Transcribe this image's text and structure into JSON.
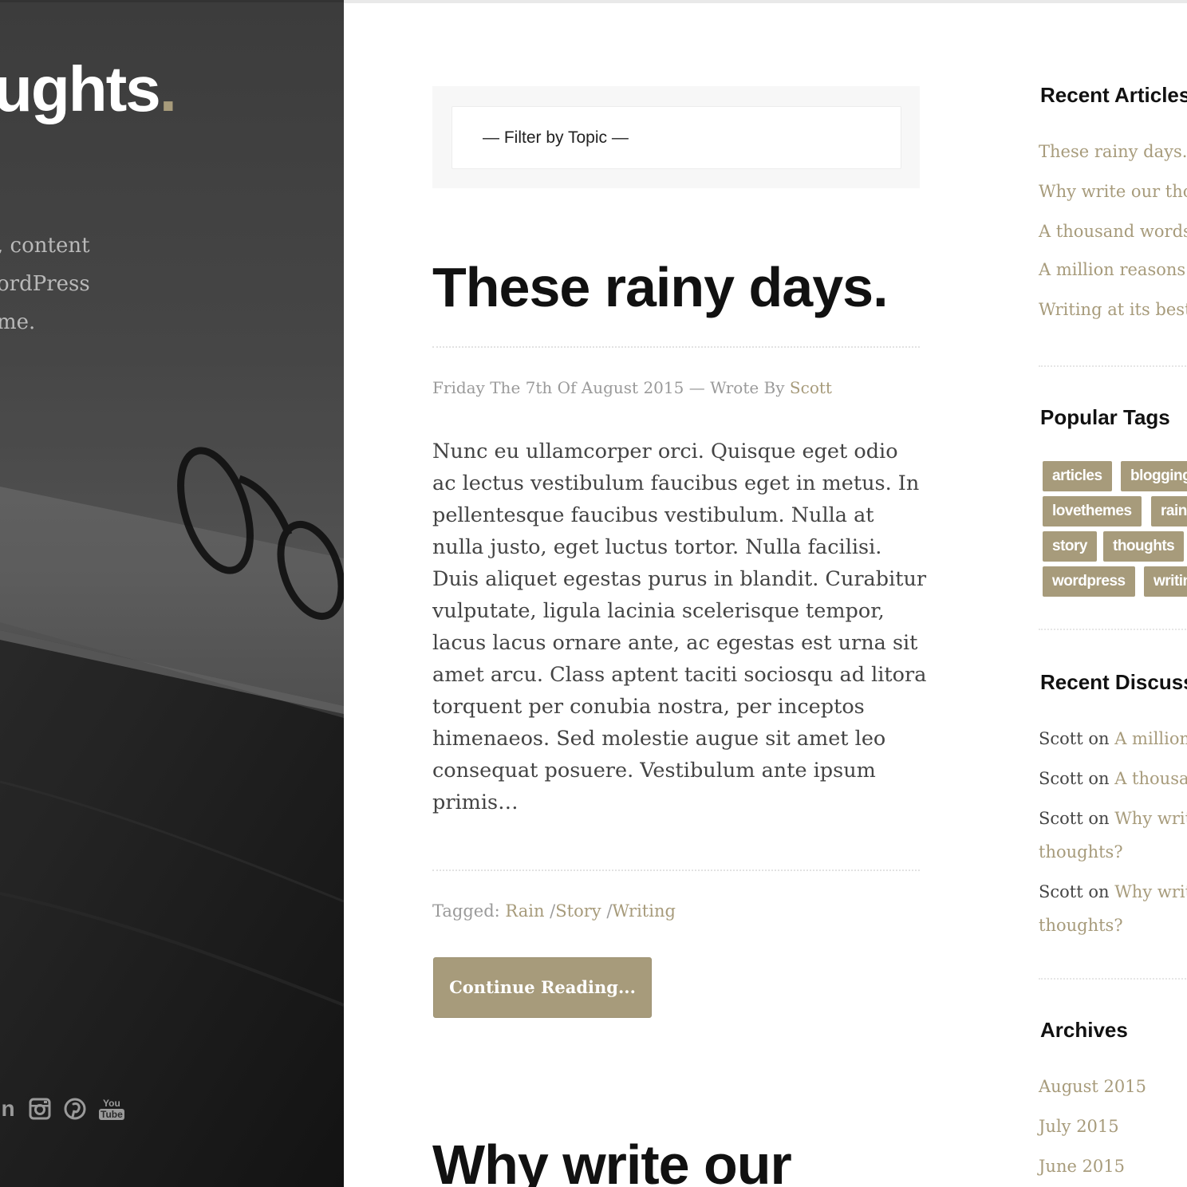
{
  "site": {
    "title_main": "ughts",
    "title_dot": ".",
    "description_lines": [
      ", content",
      "ordPress",
      "me."
    ]
  },
  "social": {
    "icons": [
      "linkedin-icon",
      "instagram-icon",
      "pinterest-icon",
      "youtube-icon"
    ],
    "linkedin_glyph": "n",
    "youtube_label_top": "You",
    "youtube_label_bottom": "Tube"
  },
  "filter": {
    "label": "— Filter by Topic —"
  },
  "post": {
    "title": "These rainy days.",
    "meta_prefix": "Friday The 7th Of August 2015 — Wrote By ",
    "author": "Scott",
    "excerpt": "Nunc eu ullamcorper orci. Quisque eget odio ac lectus vestibulum faucibus eget in metus. In pellentesque faucibus vestibulum. Nulla at nulla justo, eget luctus tortor. Nulla facilisi. Duis aliquet egestas purus in blandit. Curabitur vulputate, ligula lacinia scelerisque tempor, lacus lacus ornare ante, ac egestas est urna sit amet arcu. Class aptent taciti sociosqu ad litora torquent per conubia nostra, per inceptos himenaeos. Sed molestie augue sit amet leo consequat posuere. Vestibulum ante ipsum primis…",
    "tagged_label": "Tagged:",
    "tags": [
      "Rain",
      "Story",
      "Writing"
    ],
    "tag_separator": "/",
    "continue_label": "Continue Reading..."
  },
  "post2": {
    "title": "Why write our"
  },
  "sidebar": {
    "recent_articles": {
      "title": "Recent Articles",
      "items": [
        "These rainy days.",
        "Why write our thou",
        "A thousand words.",
        "A million reasons.",
        "Writing at its best."
      ]
    },
    "popular_tags": {
      "title": "Popular Tags",
      "items": [
        "articles",
        "blogging",
        "lovethemes",
        "rain",
        "story",
        "thoughts",
        "wordpress",
        "writing"
      ]
    },
    "recent_discussions": {
      "title": "Recent Discuss",
      "on_word": "on",
      "items": [
        {
          "author": "Scott",
          "post": "A million r"
        },
        {
          "author": "Scott",
          "post": "A thousan"
        },
        {
          "author": "Scott",
          "post": "Why write",
          "post_line2": "thoughts?"
        },
        {
          "author": "Scott",
          "post": "Why write",
          "post_line2": "thoughts?"
        }
      ]
    },
    "archives": {
      "title": "Archives",
      "items": [
        "August 2015",
        "July 2015",
        "June 2015"
      ]
    }
  },
  "colors": {
    "accent": "#a79b7b",
    "title": "#111111",
    "body": "#444444",
    "muted": "#9a9a9a"
  }
}
